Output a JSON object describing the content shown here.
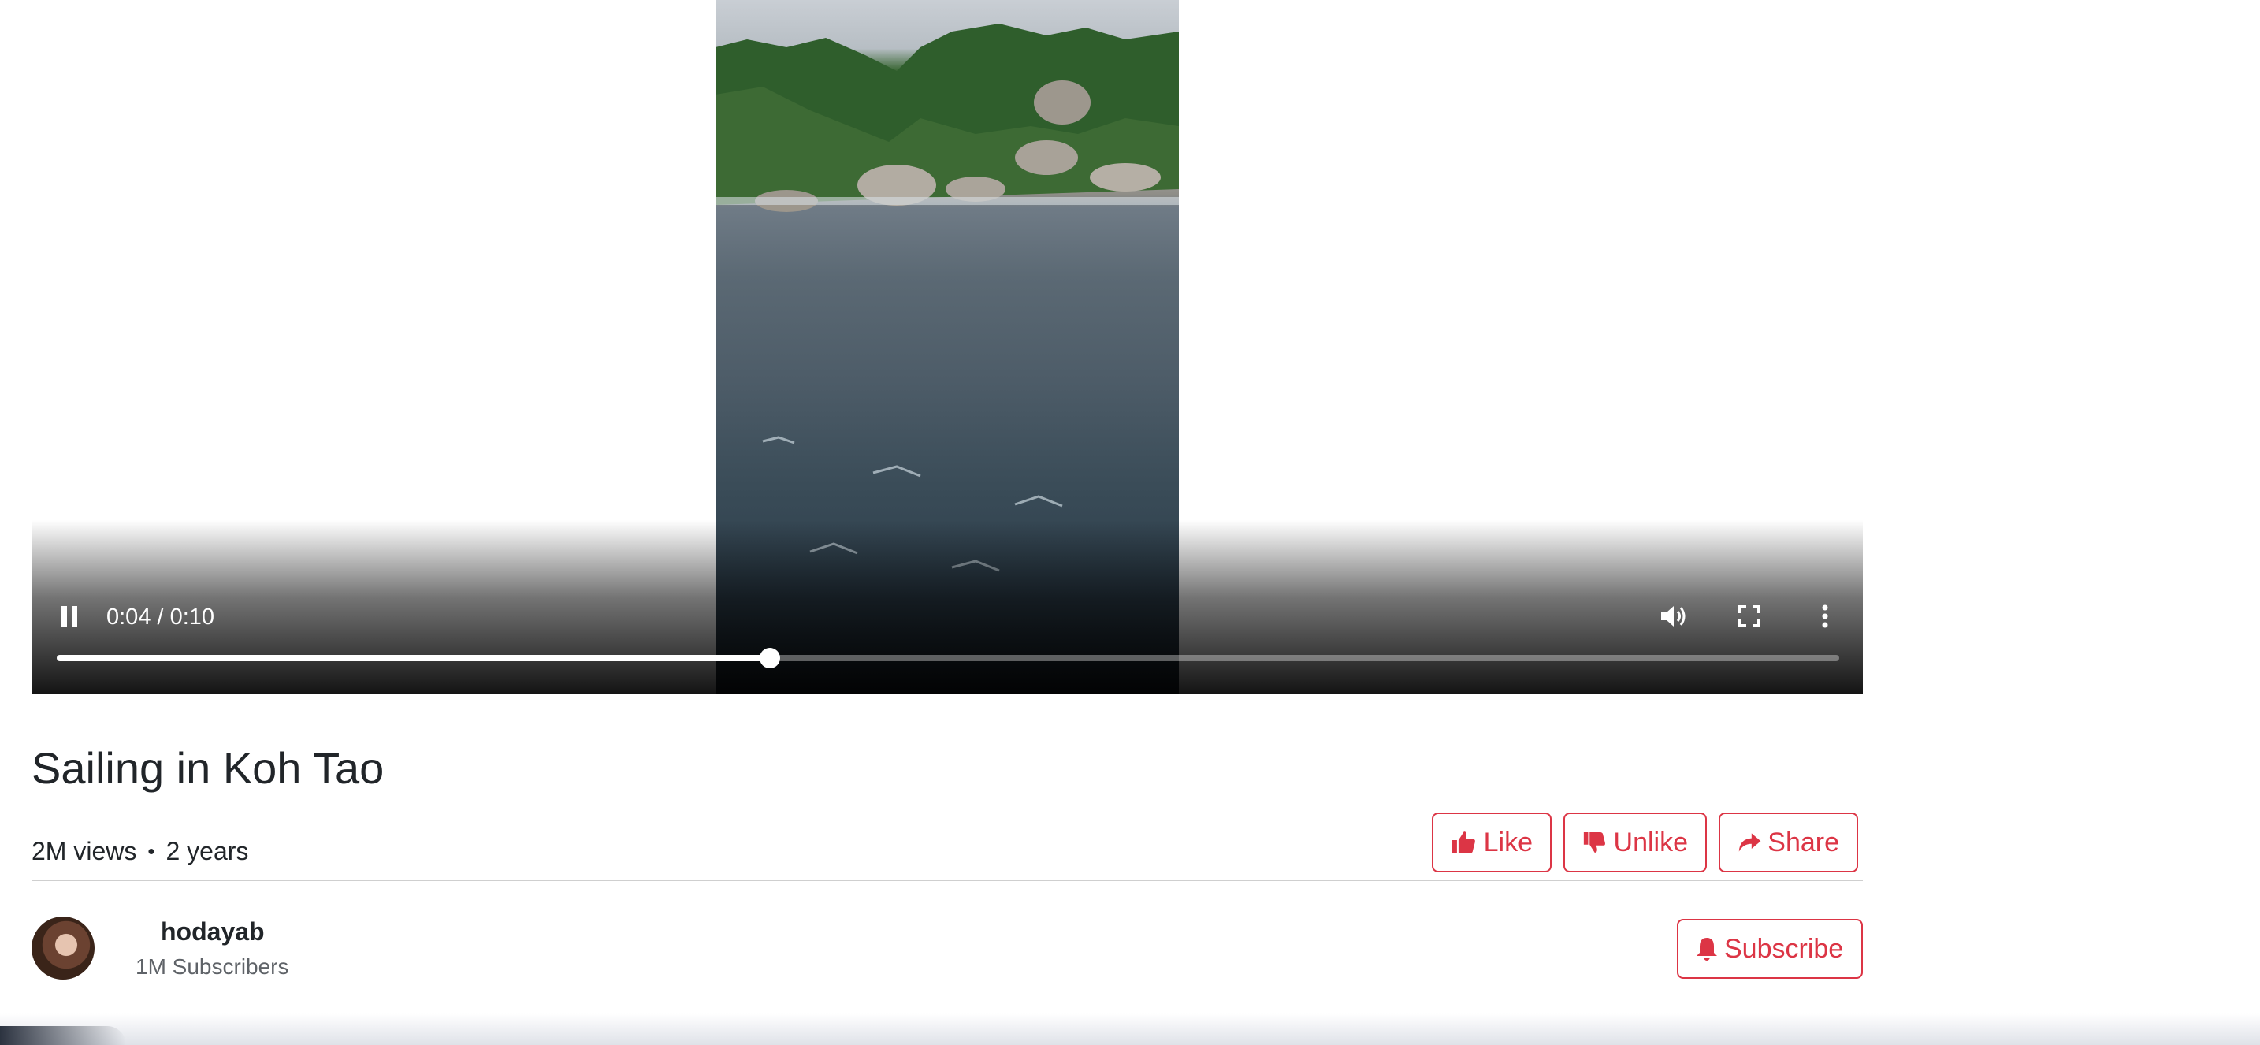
{
  "video": {
    "time_display": "0:04 / 0:10",
    "progress": 0.4,
    "controls": {
      "play_pause_icon": "pause-icon",
      "volume_icon": "volume-icon",
      "fullscreen_icon": "fullscreen-icon",
      "more_icon": "more-vert-icon"
    }
  },
  "title": "Sailing in Koh Tao",
  "stats": {
    "views": "2M views",
    "separator": "•",
    "age": "2 years"
  },
  "actions": {
    "like": "Like",
    "unlike": "Unlike",
    "share": "Share"
  },
  "channel": {
    "name": "hodayab",
    "subscribers": "1M Subscribers",
    "subscribe": "Subscribe"
  },
  "colors": {
    "accent": "#dc3545",
    "text": "#212529"
  }
}
